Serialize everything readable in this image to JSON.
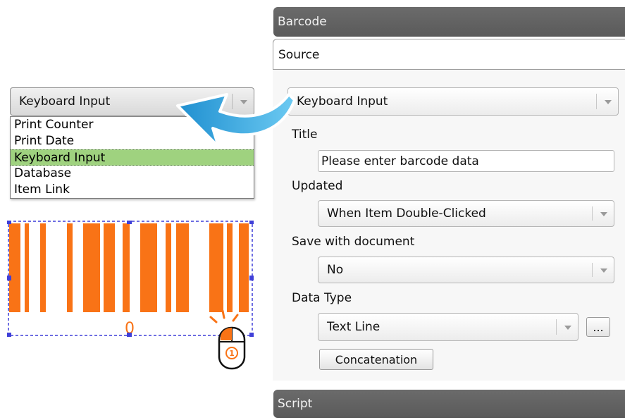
{
  "barcode_section": {
    "title": "Barcode",
    "source_tab": "Source",
    "source_combo": "Keyboard Input",
    "title_label": "Title",
    "title_value": "Please enter barcode data",
    "updated_label": "Updated",
    "updated_value": "When Item Double-Clicked",
    "save_label": "Save with document",
    "save_value": "No",
    "datatype_label": "Data Type",
    "datatype_value": "Text Line",
    "browse_button": "...",
    "concatenation_button": "Concatenation"
  },
  "script_section": {
    "title": "Script"
  },
  "left_dropdown": {
    "selected": "Keyboard Input",
    "options": [
      "Print Counter",
      "Print Date",
      "Keyboard Input",
      "Database",
      "Item Link"
    ]
  },
  "barcode_preview": {
    "text": "0",
    "mouse_badge": "①"
  },
  "colors": {
    "barcode": "#f97316",
    "selection": "#9fd27f",
    "header": "#5f5f5f",
    "arrow": "#2fa8e0",
    "handles": "#3f3fd8"
  },
  "icons": [
    "dropdown-arrow-icon",
    "curved-arrow-icon",
    "mouse-icon",
    "click-burst-icon"
  ]
}
